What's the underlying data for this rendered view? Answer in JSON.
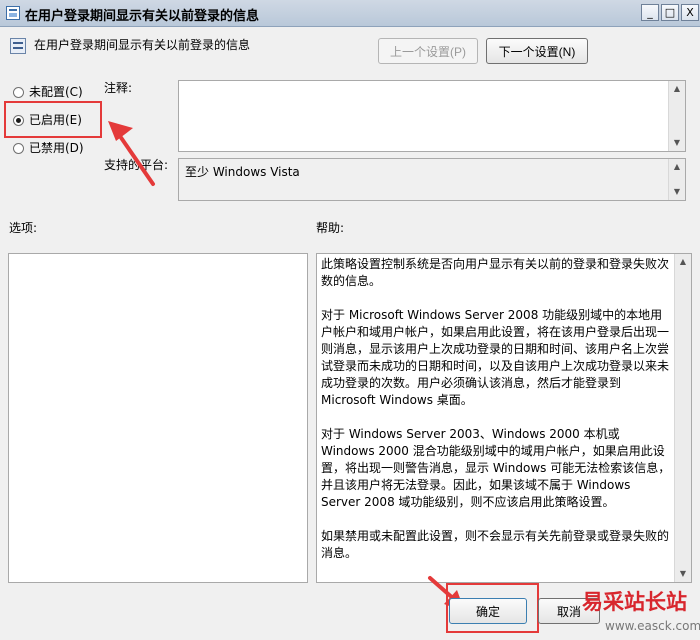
{
  "window": {
    "title": "在用户登录期间显示有关以前登录的信息",
    "minimize_glyph": "_",
    "maximize_glyph": "□",
    "close_glyph": "X"
  },
  "header": {
    "policy_name": "在用户登录期间显示有关以前登录的信息",
    "prev_button": "上一个设置(P)",
    "next_button": "下一个设置(N)"
  },
  "radios": [
    {
      "label": "未配置(C)",
      "checked": false
    },
    {
      "label": "已启用(E)",
      "checked": true
    },
    {
      "label": "已禁用(D)",
      "checked": false
    }
  ],
  "labels": {
    "comment": "注释:",
    "supported_on": "支持的平台:",
    "options": "选项:",
    "help": "帮助:"
  },
  "fields": {
    "comment_value": "",
    "supported_value": "至少 Windows Vista"
  },
  "help_paragraphs": [
    "此策略设置控制系统是否向用户显示有关以前的登录和登录失败次数的信息。",
    "对于 Microsoft Windows Server 2008 功能级别域中的本地用户帐户和域用户帐户，如果启用此设置，将在该用户登录后出现一则消息，显示该用户上次成功登录的日期和时间、该用户名上次尝试登录而未成功的日期和时间，以及自该用户上次成功登录以来未成功登录的次数。用户必须确认该消息，然后才能登录到 Microsoft Windows 桌面。",
    "对于 Windows Server 2003、Windows 2000 本机或 Windows 2000 混合功能级别域中的域用户帐户，如果启用此设置，将出现一则警告消息，显示 Windows 可能无法检索该信息，并且该用户将无法登录。因此，如果该域不属于 Windows Server 2008 域功能级别，则不应该启用此策略设置。",
    "如果禁用或未配置此设置，则不会显示有关先前登录或登录失败的消息。"
  ],
  "footer": {
    "ok_button": "确定",
    "cancel_button": "取消"
  },
  "watermark": {
    "main": "易采站长站",
    "sub": "www.easck.com"
  },
  "colors": {
    "annotation_red": "#e43a3a",
    "watermark_red": "#d8262d"
  }
}
